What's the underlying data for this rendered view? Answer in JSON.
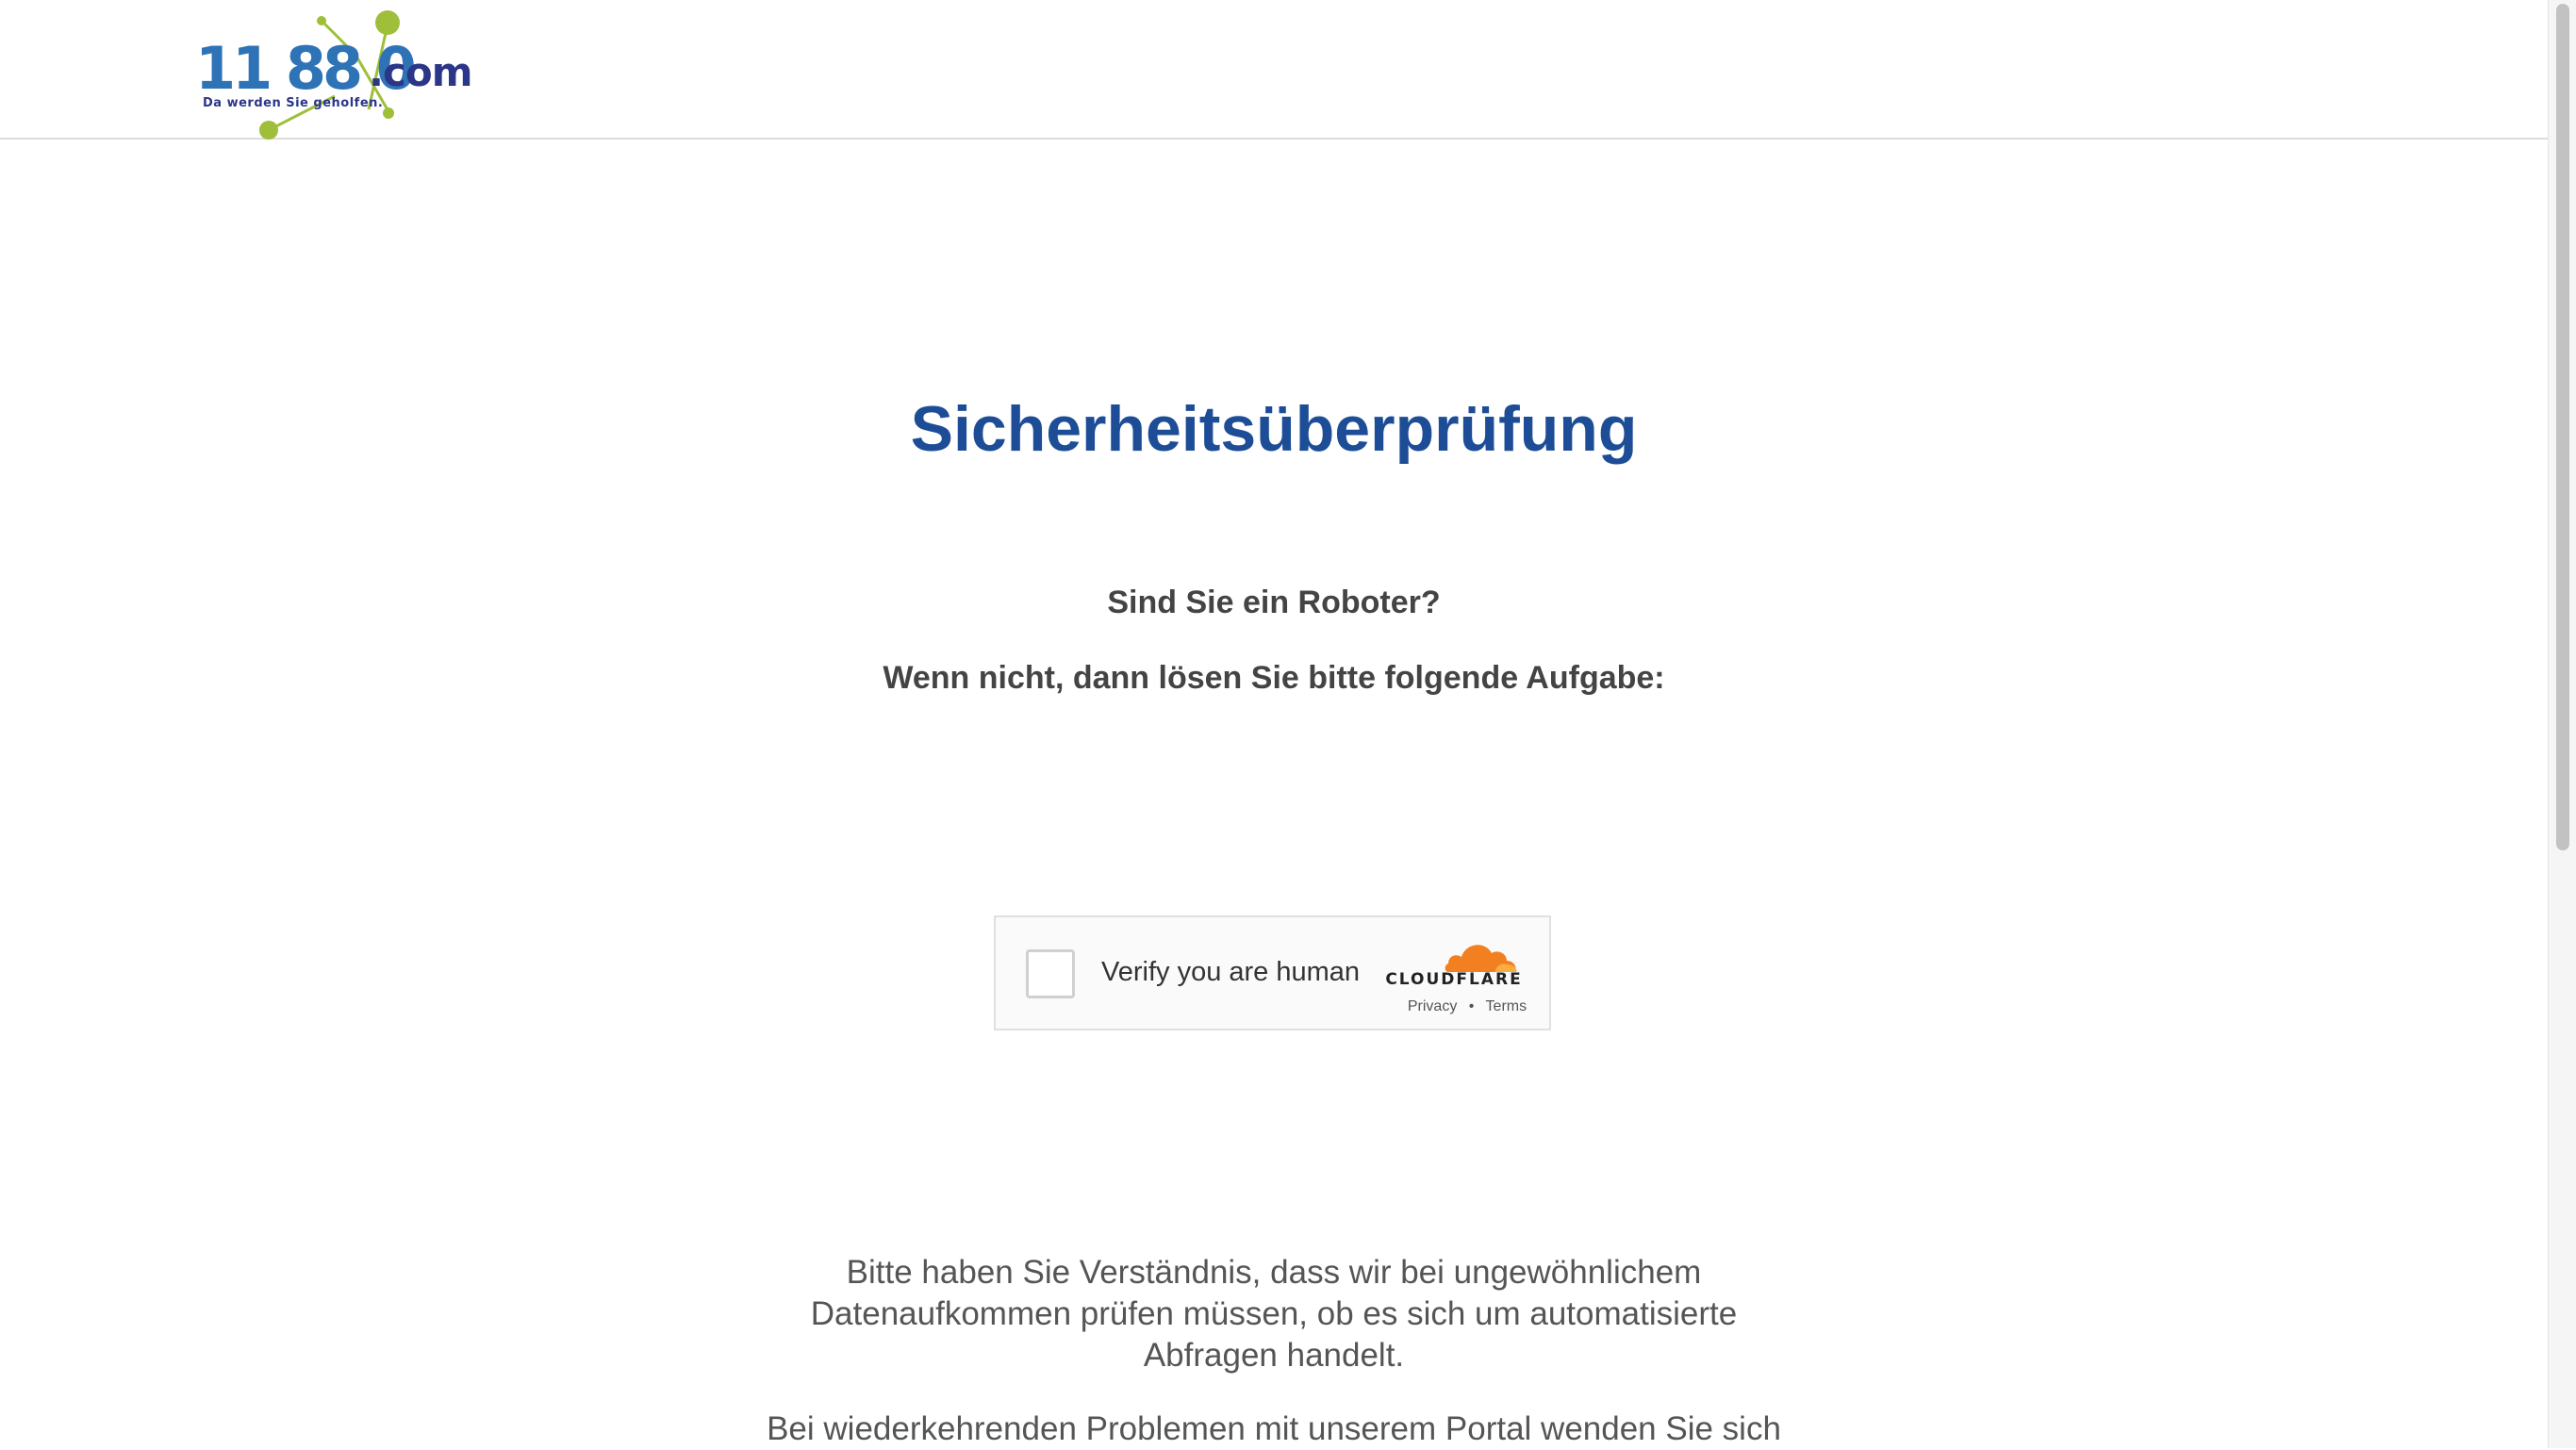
{
  "header": {
    "logo_digits": "11 88 0",
    "logo_domain": ".com",
    "logo_tagline": "Da werden Sie geholfen."
  },
  "main": {
    "title": "Sicherheitsüberprüfung",
    "question": "Sind Sie ein Roboter?",
    "instruction": "Wenn nicht, dann lösen Sie bitte folgende Aufgabe:",
    "paragraph_1": "Bitte haben Sie Verständnis, dass wir bei ungewöhnlichem Datenaufkommen prüfen müssen, ob es sich um automatisierte Abfragen handelt.",
    "paragraph_2": "Bei wiederkehrenden Problemen mit unserem Portal wenden Sie sich"
  },
  "captcha": {
    "label": "Verify you are human",
    "brand": "CLOUDFLARE",
    "privacy_link": "Privacy",
    "separator": "•",
    "terms_link": "Terms",
    "checked": false
  },
  "colors": {
    "title": "#1d4d96",
    "body_text": "#555555",
    "logo_blue": "#2f73b7",
    "logo_navy": "#2b3688",
    "logo_green": "#9fbf3b",
    "cloudflare_orange": "#f38020"
  }
}
